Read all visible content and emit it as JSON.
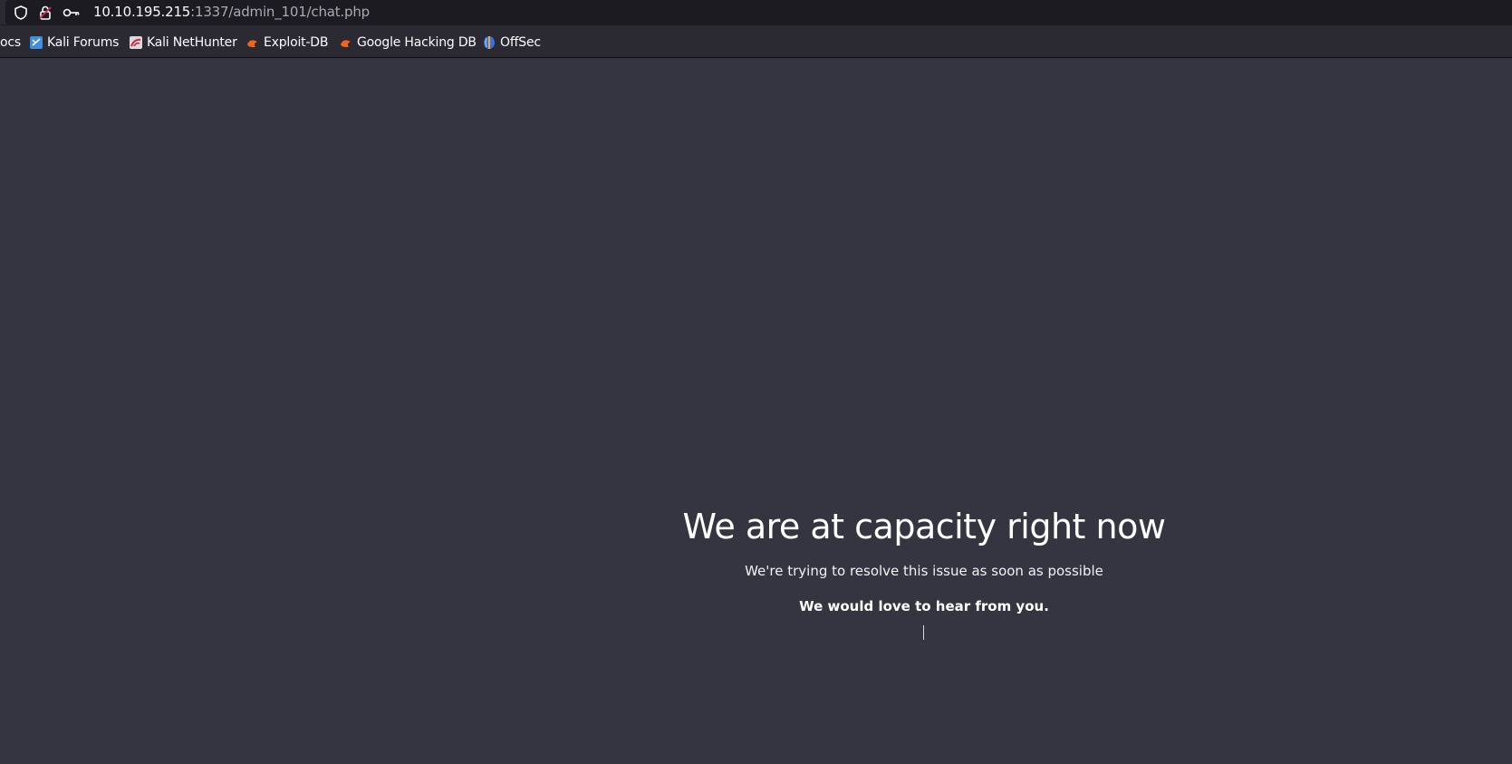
{
  "browser": {
    "url_host": "10.10.195.215",
    "url_rest": ":1337/admin_101/chat.php",
    "bookmarks": [
      {
        "label": "ocs",
        "icon": "none"
      },
      {
        "label": "Kali Forums",
        "icon": "kali-forums-icon"
      },
      {
        "label": "Kali NetHunter",
        "icon": "kali-nethunter-icon"
      },
      {
        "label": "Exploit-DB",
        "icon": "exploit-db-icon"
      },
      {
        "label": "Google Hacking DB",
        "icon": "google-hacking-db-icon"
      },
      {
        "label": "OffSec",
        "icon": "offsec-icon"
      }
    ]
  },
  "page": {
    "headline": "We are at capacity right now",
    "subtext": "We're trying to resolve this issue as soon as possible",
    "feedback": "We would love to hear from you."
  },
  "colors": {
    "page_background": "#353542",
    "toolbar_background": "#2b2a33",
    "urlbar_background": "#1c1b22",
    "text": "#ffffff"
  }
}
